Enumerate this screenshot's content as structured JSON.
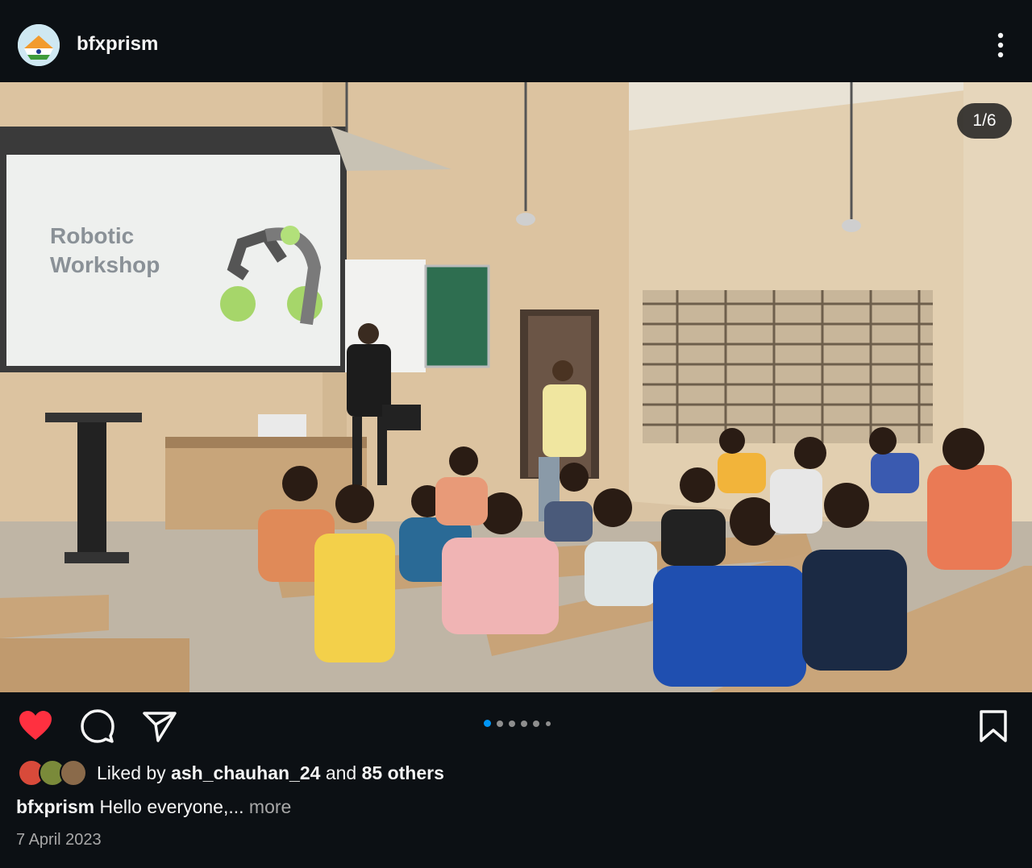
{
  "header": {
    "username": "bfxprism",
    "more_icon": "more-vertical-icon"
  },
  "post": {
    "image_counter": "1/6",
    "slide_text": "Robotic Workshop",
    "carousel_total": 6,
    "carousel_active": 1
  },
  "actions": {
    "like_icon": "heart-filled-icon",
    "comment_icon": "comment-icon",
    "share_icon": "send-icon",
    "save_icon": "bookmark-icon",
    "like_color": "#ff3040",
    "active_dot_color": "#0095f6"
  },
  "likes": {
    "prefix": "Liked by",
    "user": "ash_chauhan_24",
    "middle": "and",
    "others": "85 others"
  },
  "caption": {
    "username": "bfxprism",
    "text": "Hello everyone,...",
    "more": "more"
  },
  "date": "7 April 2023"
}
